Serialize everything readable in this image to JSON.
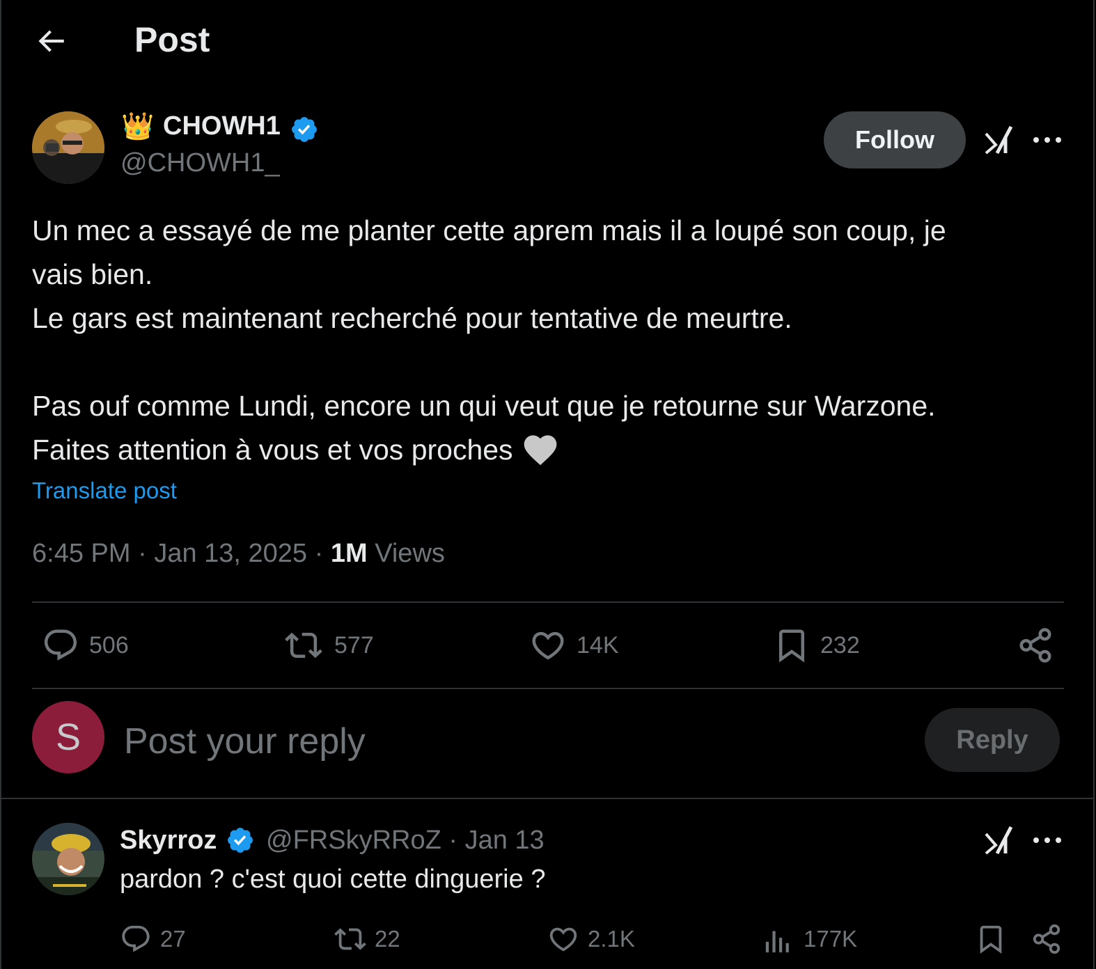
{
  "header": {
    "title": "Post"
  },
  "post": {
    "author": {
      "crown": "👑",
      "display_name": "CHOWH1",
      "handle": "@CHOWH1_"
    },
    "follow_label": "Follow",
    "text": "Un mec a essayé de me planter cette aprem mais il a loupé son coup, je\nvais bien.\nLe gars est maintenant recherché pour tentative de meurtre.\n\nPas ouf comme Lundi, encore un qui veut que je retourne sur Warzone.\nFaites attention à vous et vos proches ",
    "emoji": "white-heart-icon",
    "translate_label": "Translate post",
    "time": "6:45 PM",
    "date": "Jan 13, 2025",
    "views_count": "1M",
    "views_label": "Views",
    "stats": {
      "replies": "506",
      "reposts": "577",
      "likes": "14K",
      "bookmarks": "232"
    }
  },
  "composer": {
    "avatar_letter": "S",
    "placeholder": "Post your reply",
    "button_label": "Reply"
  },
  "reply": {
    "display_name": "Skyrroz",
    "handle": "@FRSkyRRoZ",
    "date": "Jan 13",
    "text": "pardon ? c'est quoi cette dinguerie ?",
    "stats": {
      "replies": "27",
      "reposts": "22",
      "likes": "2.1K",
      "views": "177K"
    }
  },
  "colors": {
    "background": "#000000",
    "text": "#e7e9ea",
    "secondary": "#71767b",
    "link": "#1d9bf0",
    "verified": "#1d9bf0",
    "composer_avatar": "#8b1d3a"
  }
}
